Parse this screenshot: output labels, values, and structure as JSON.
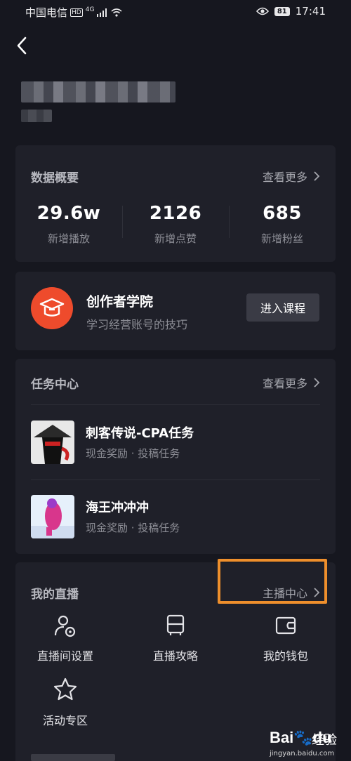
{
  "status": {
    "carrier": "中国电信",
    "hd": "HD",
    "network": "4G",
    "battery": "81",
    "time": "17:41"
  },
  "overview": {
    "title": "数据概要",
    "more": "查看更多",
    "stats": [
      {
        "value": "29.6w",
        "label": "新增播放"
      },
      {
        "value": "2126",
        "label": "新增点赞"
      },
      {
        "value": "685",
        "label": "新增粉丝"
      }
    ]
  },
  "academy": {
    "title": "创作者学院",
    "subtitle": "学习经营账号的技巧",
    "button": "进入课程"
  },
  "tasks": {
    "title": "任务中心",
    "more": "查看更多",
    "items": [
      {
        "name": "刺客传说-CPA任务",
        "desc": "现金奖励 · 投稿任务"
      },
      {
        "name": "海王冲冲冲",
        "desc": "现金奖励 · 投稿任务"
      }
    ]
  },
  "live": {
    "title": "我的直播",
    "more": "主播中心",
    "items": [
      {
        "label": "直播间设置",
        "icon": "user-gear-icon"
      },
      {
        "label": "直播攻略",
        "icon": "bus-icon"
      },
      {
        "label": "我的钱包",
        "icon": "wallet-icon"
      },
      {
        "label": "活动专区",
        "icon": "star-icon"
      }
    ]
  },
  "watermark": {
    "logo": "Bai",
    "logo2": "du",
    "text": "经验",
    "url": "jingyan.baidu.com"
  },
  "colors": {
    "background": "#16171f",
    "card": "#1f2029",
    "accent": "#ee4b2c",
    "highlight": "#ee8f2c"
  }
}
